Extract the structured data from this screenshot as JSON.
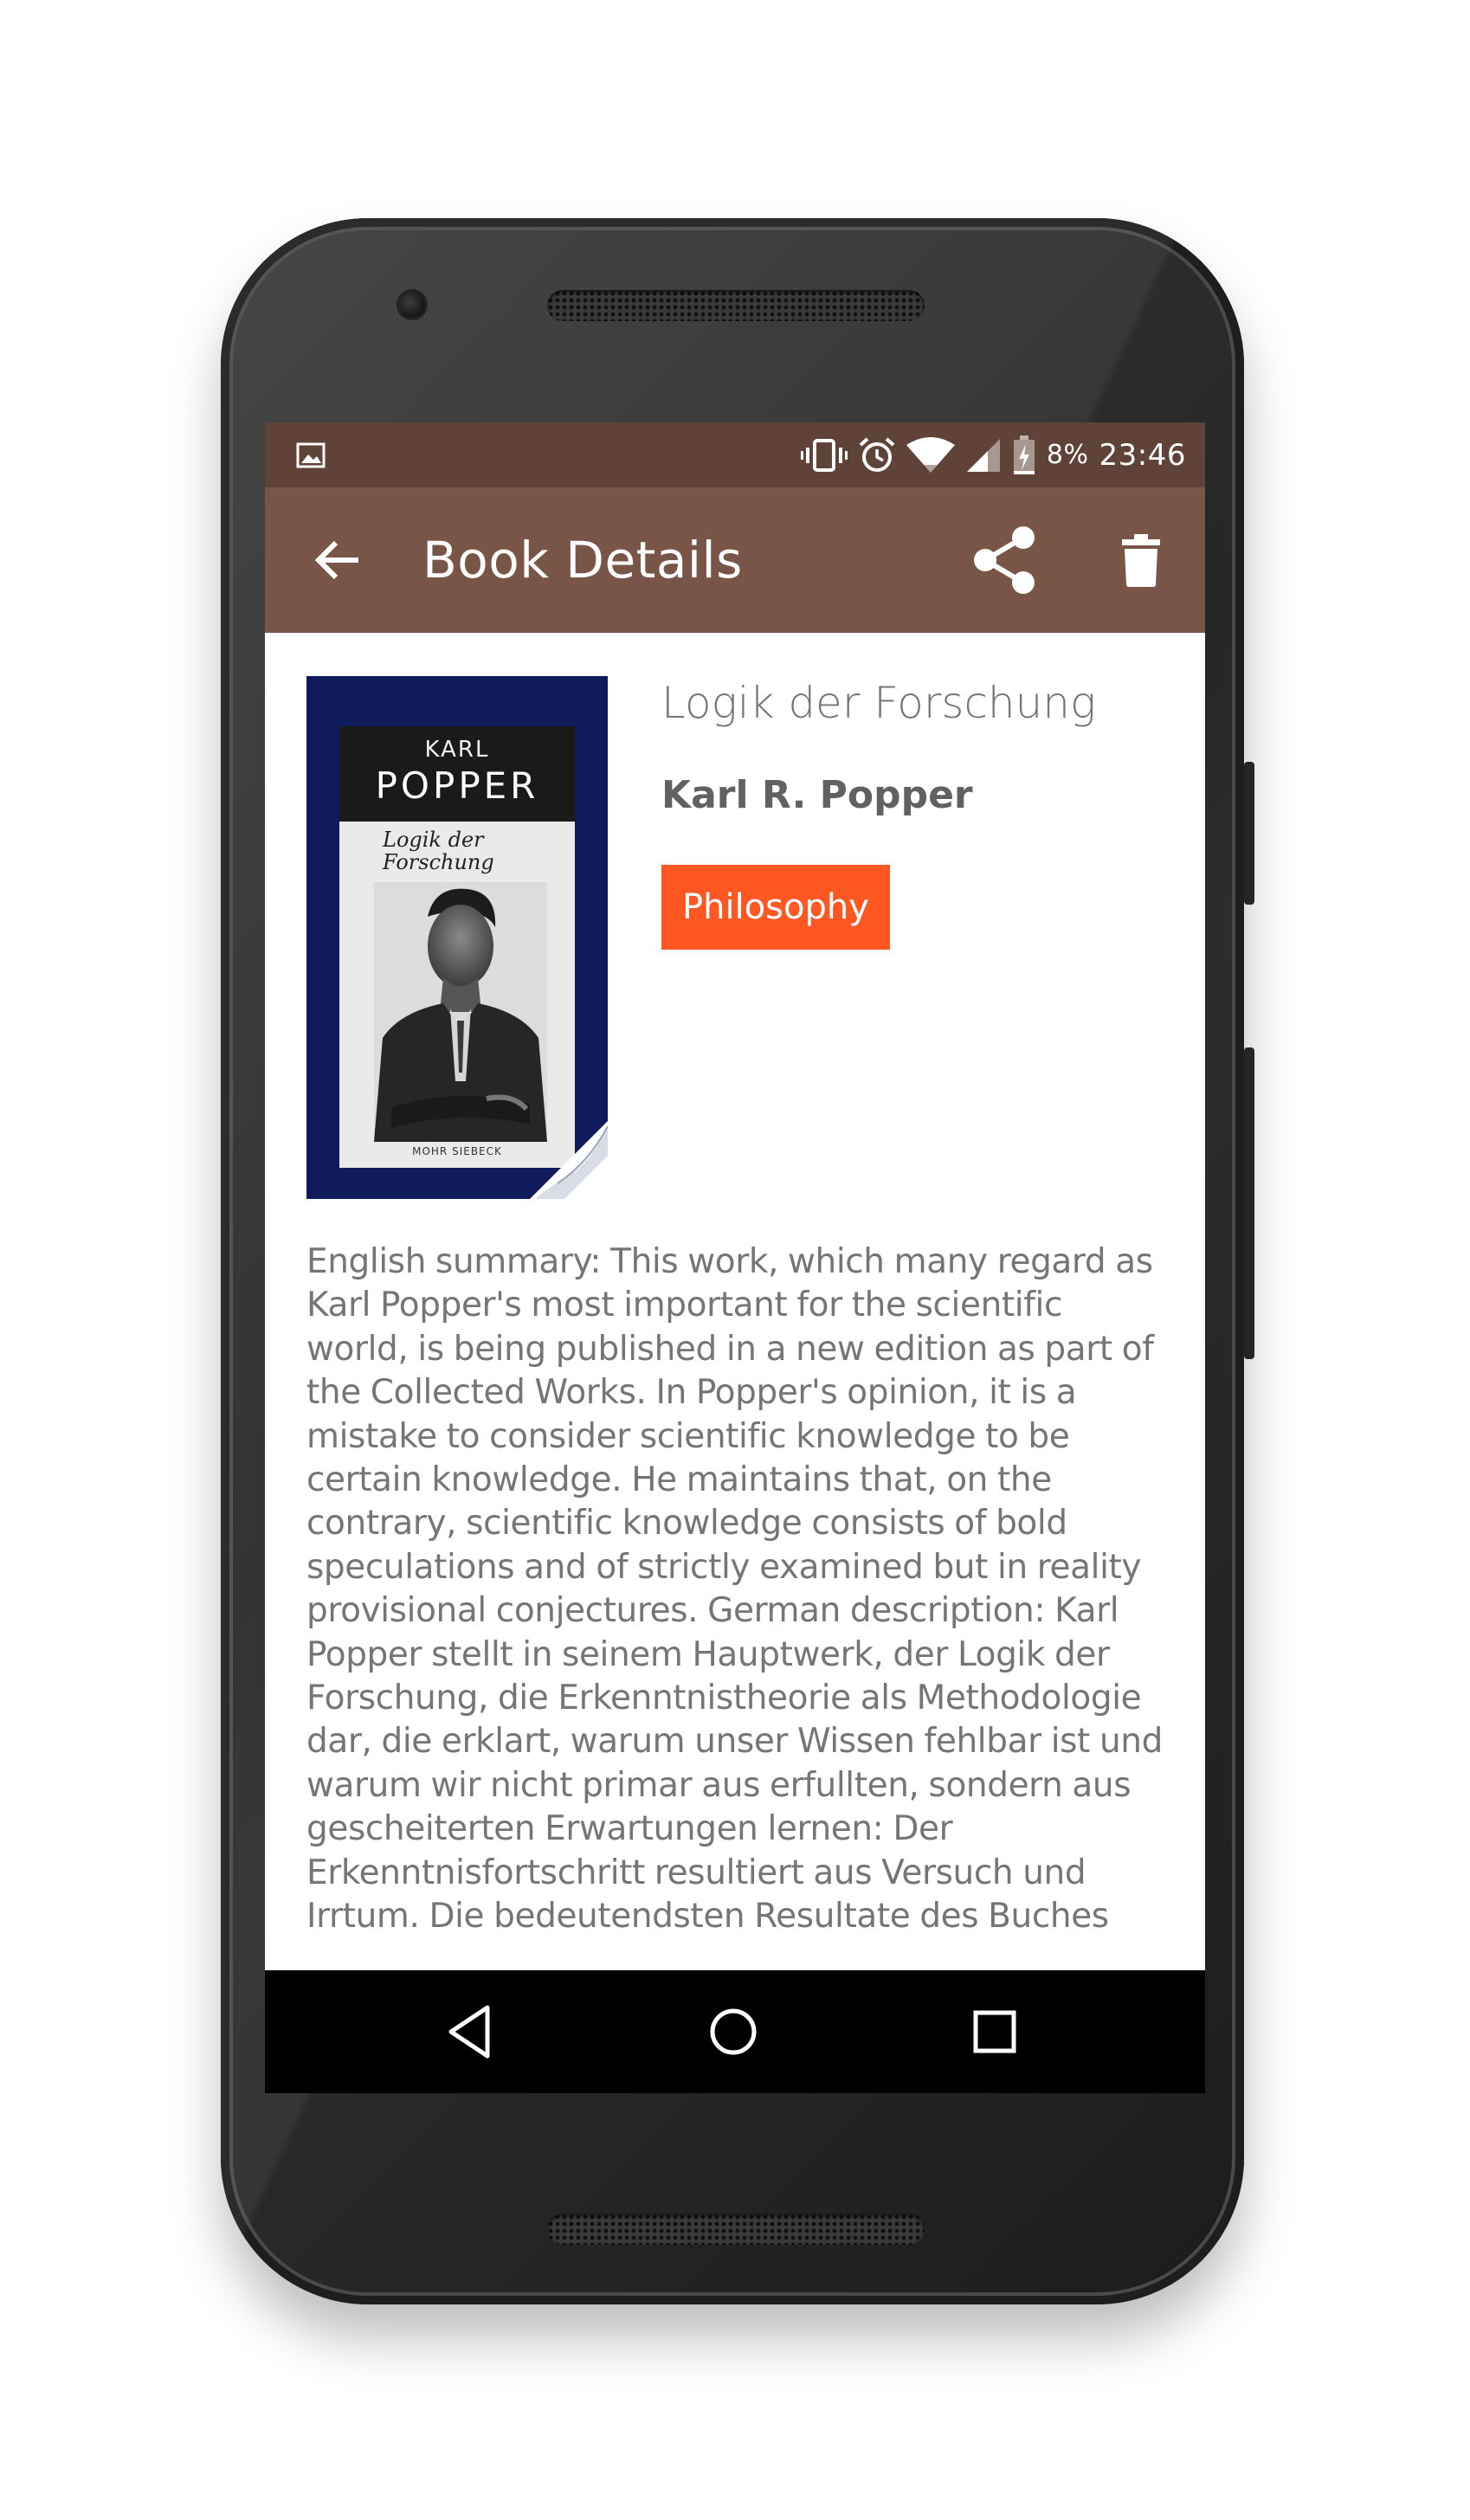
{
  "status_bar": {
    "battery_percent": "8%",
    "time": "23:46",
    "icons": [
      "image-notification-icon",
      "vibrate-icon",
      "alarm-icon",
      "wifi-icon",
      "cell-signal-icon",
      "battery-charging-icon"
    ]
  },
  "app_bar": {
    "title": "Book Details",
    "back_icon": "arrow-back-icon",
    "share_icon": "share-icon",
    "delete_icon": "delete-icon",
    "background_color": "#795548",
    "status_color": "#5f4338"
  },
  "book": {
    "title": "Logik der Forschung",
    "author": "Karl R. Popper",
    "genre": "Philosophy",
    "genre_color": "#ff5722",
    "cover": {
      "author_first": "KARL",
      "author_last": "POPPER",
      "subtitle": "Logik der Forschung",
      "publisher": "MOHR SIEBECK"
    },
    "description": "English summary: This work, which many regard as Karl Popper's most important for the scientific world, is being published in a new edition as part of the Collected Works. In Popper's opinion, it is a mistake to consider scientific knowledge to be certain knowledge. He maintains that, on the contrary, scientific knowledge consists of bold speculations and of strictly examined but in reality provisional conjectures. German description: Karl Popper stellt in seinem Hauptwerk, der Logik der Forschung, die Erkenntnistheorie als Methodologie dar, die erklart, warum unser Wissen fehlbar ist und warum wir nicht primar aus erfullten, sondern aus gescheiterten Erwartungen lernen: Der Erkenntnisfortschritt resultiert aus Versuch und Irrtum. Die bedeutendsten Resultate des Buches"
  },
  "nav_bar": {
    "buttons": [
      "nav-back-icon",
      "nav-home-icon",
      "nav-recents-icon"
    ]
  }
}
